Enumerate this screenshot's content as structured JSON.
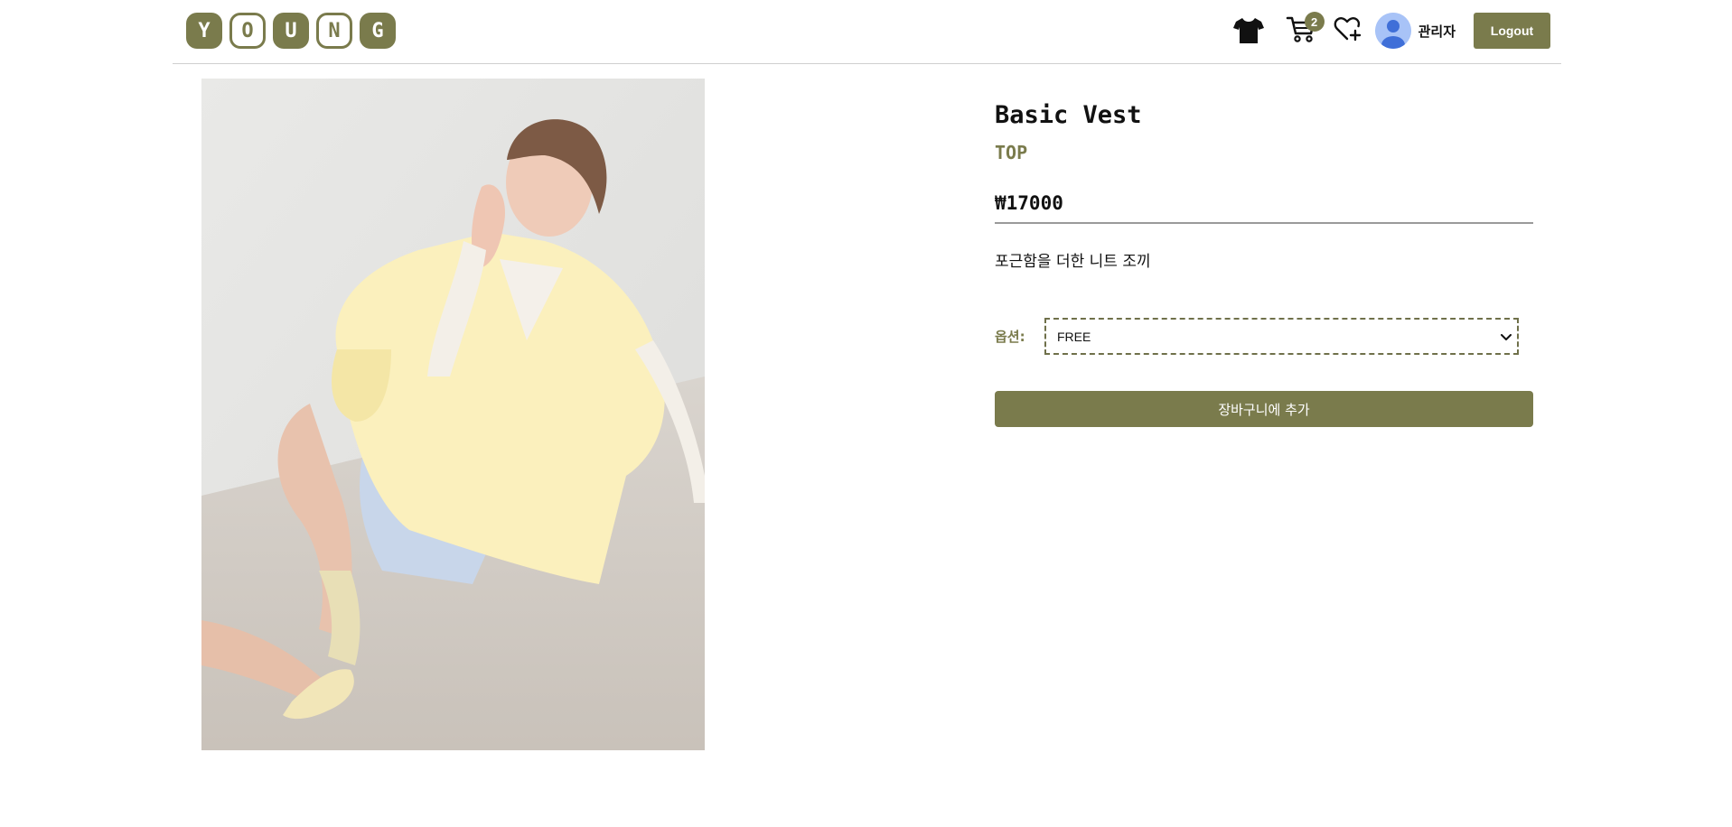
{
  "header": {
    "logo_letters": [
      "Y",
      "O",
      "U",
      "N",
      "G"
    ],
    "cart_count": "2",
    "user_name": "관리자",
    "logout_label": "Logout",
    "icons": [
      "tshirt-icon",
      "cart-icon",
      "heart-plus-icon",
      "user-avatar-icon"
    ]
  },
  "product": {
    "name": "Basic Vest",
    "category": "TOP",
    "price": "₩17000",
    "description": "포근함을 더한 니트 조끼",
    "option_label": "옵션:",
    "option_selected": "FREE",
    "add_to_cart_label": "장바구니에 추가"
  },
  "colors": {
    "accent": "#7a7b4c",
    "avatar_bg": "#a8c3f7",
    "divider": "#cfcfcf"
  }
}
